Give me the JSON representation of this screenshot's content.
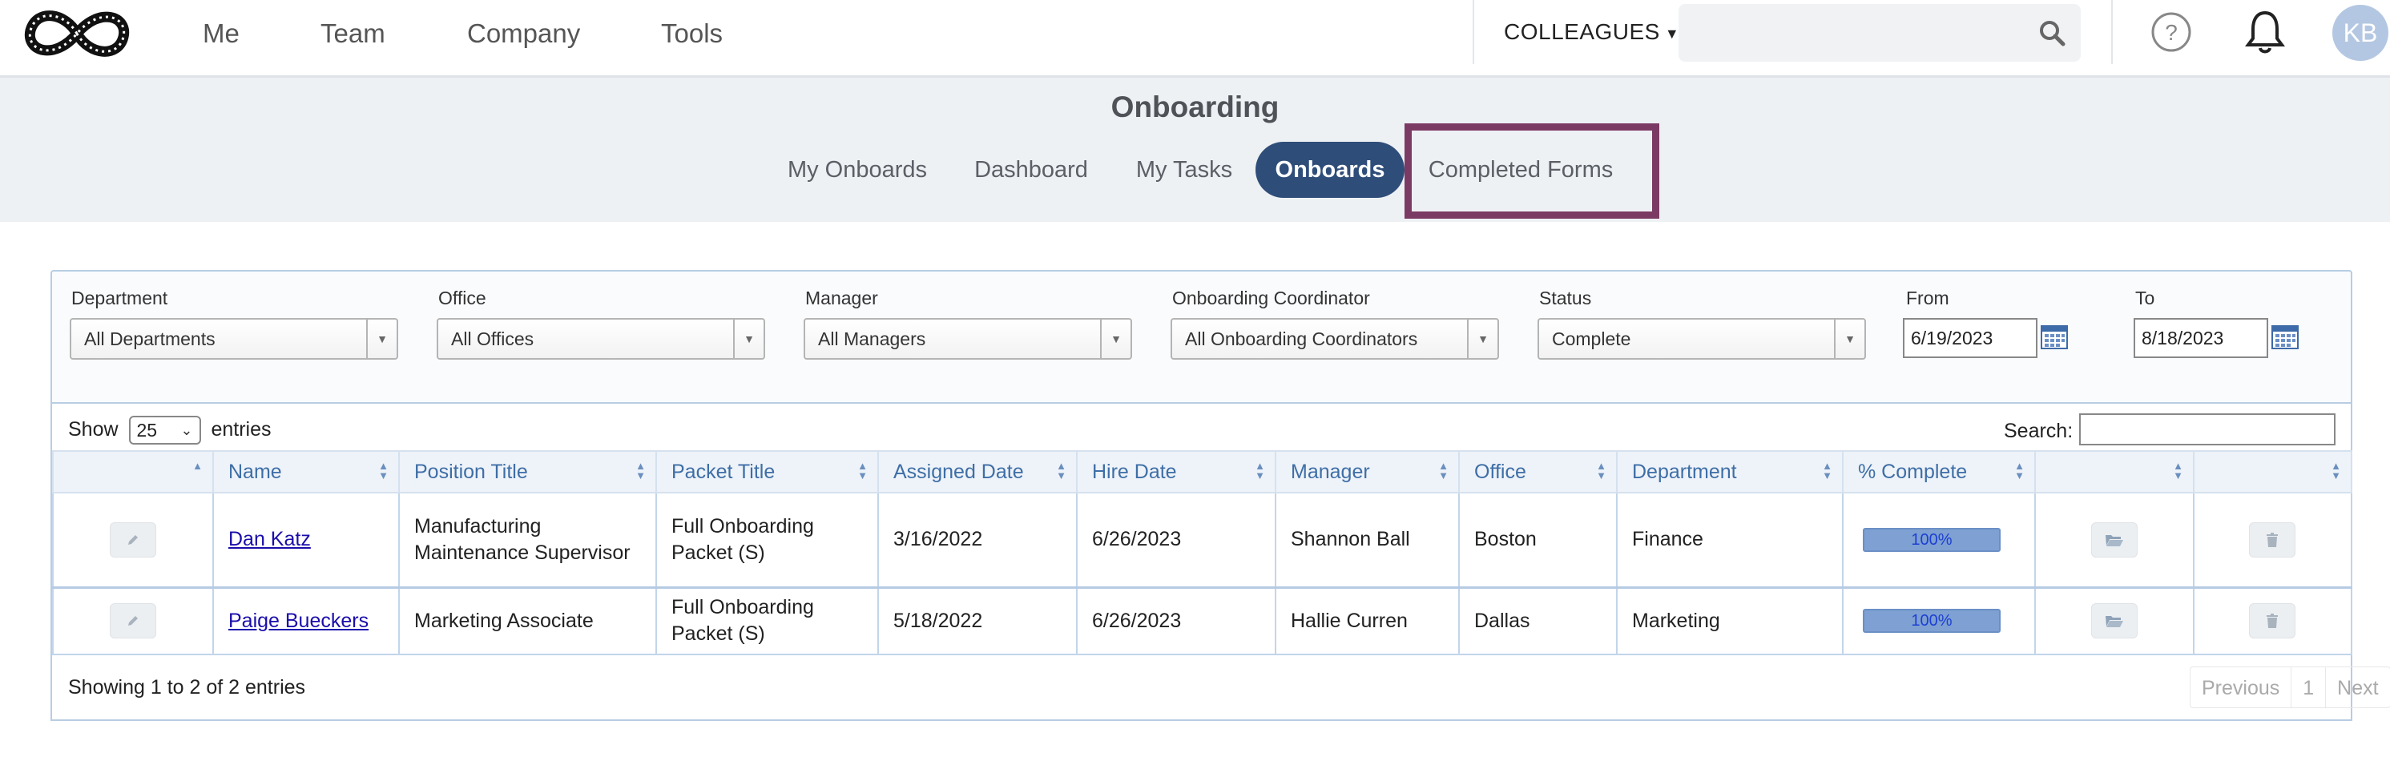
{
  "colors": {
    "accent": "#2f4d79",
    "highlight": "#7b3a64",
    "link": "#1a0dab",
    "progress": "#7ea0d2"
  },
  "topnav": {
    "items": [
      "Me",
      "Team",
      "Company",
      "Tools"
    ],
    "colleagues_label": "COLLEAGUES",
    "search_placeholder": "",
    "avatar_initials": "KB",
    "icons": [
      "logo-infinity",
      "search-icon",
      "help-icon",
      "bell-icon"
    ]
  },
  "subheader": {
    "title": "Onboarding",
    "tabs": [
      {
        "label": "My Onboards",
        "active": false
      },
      {
        "label": "Dashboard",
        "active": false
      },
      {
        "label": "My Tasks",
        "active": false
      },
      {
        "label": "Onboards",
        "active": true
      },
      {
        "label": "Completed Forms",
        "active": false,
        "highlighted": true
      }
    ]
  },
  "filters": {
    "department": {
      "label": "Department",
      "value": "All Departments"
    },
    "office": {
      "label": "Office",
      "value": "All Offices"
    },
    "manager": {
      "label": "Manager",
      "value": "All Managers"
    },
    "coordinator": {
      "label": "Onboarding Coordinator",
      "value": "All Onboarding Coordinators"
    },
    "status": {
      "label": "Status",
      "value": "Complete"
    },
    "from": {
      "label": "From",
      "value": "6/19/2023"
    },
    "to": {
      "label": "To",
      "value": "8/18/2023"
    }
  },
  "table": {
    "show_label": "Show",
    "page_length": "25",
    "entries_label": "entries",
    "search_label": "Search:",
    "search_value": "",
    "columns": [
      "",
      "Name",
      "Position Title",
      "Packet Title",
      "Assigned Date",
      "Hire Date",
      "Manager",
      "Office",
      "Department",
      "% Complete",
      "",
      ""
    ],
    "rows": [
      {
        "name": "Dan Katz",
        "position": "Manufacturing Maintenance Supervisor",
        "packet": "Full Onboarding Packet (S)",
        "assigned": "3/16/2022",
        "hire": "6/26/2023",
        "manager": "Shannon Ball",
        "office": "Boston",
        "department": "Finance",
        "complete_label": "100%",
        "complete": 1.0
      },
      {
        "name": "Paige Bueckers",
        "position": "Marketing Associate",
        "packet": "Full Onboarding Packet (S)",
        "assigned": "5/18/2022",
        "hire": "6/26/2023",
        "manager": "Hallie Curren",
        "office": "Dallas",
        "department": "Marketing",
        "complete_label": "100%",
        "complete": 1.0
      }
    ],
    "info": "Showing 1 to 2 of 2 entries",
    "pager": {
      "previous": "Previous",
      "page": "1",
      "next": "Next"
    }
  }
}
